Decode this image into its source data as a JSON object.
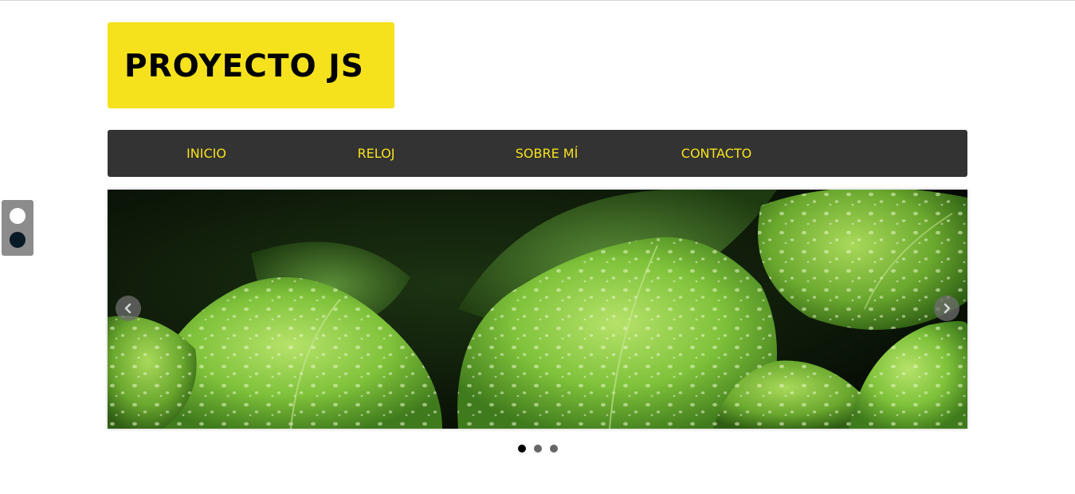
{
  "header": {
    "logo_text": "PROYECTO JS"
  },
  "menu": {
    "items": [
      {
        "label": "INICIO"
      },
      {
        "label": "RELOJ"
      },
      {
        "label": "SOBRE MÍ"
      },
      {
        "label": "CONTACTO"
      }
    ]
  },
  "theme_switcher": {
    "options": [
      {
        "name": "light",
        "color": "#ffffff"
      },
      {
        "name": "dark",
        "color": "#071a25"
      }
    ]
  },
  "slider": {
    "image": "green-leaves-with-water-drops",
    "prev_icon": "chevron-left-icon",
    "next_icon": "chevron-right-icon",
    "total_slides": 3,
    "active_slide": 1
  },
  "colors": {
    "accent": "#f5e21c",
    "menu_background": "#333333",
    "menu_text": "#f5e21c"
  }
}
